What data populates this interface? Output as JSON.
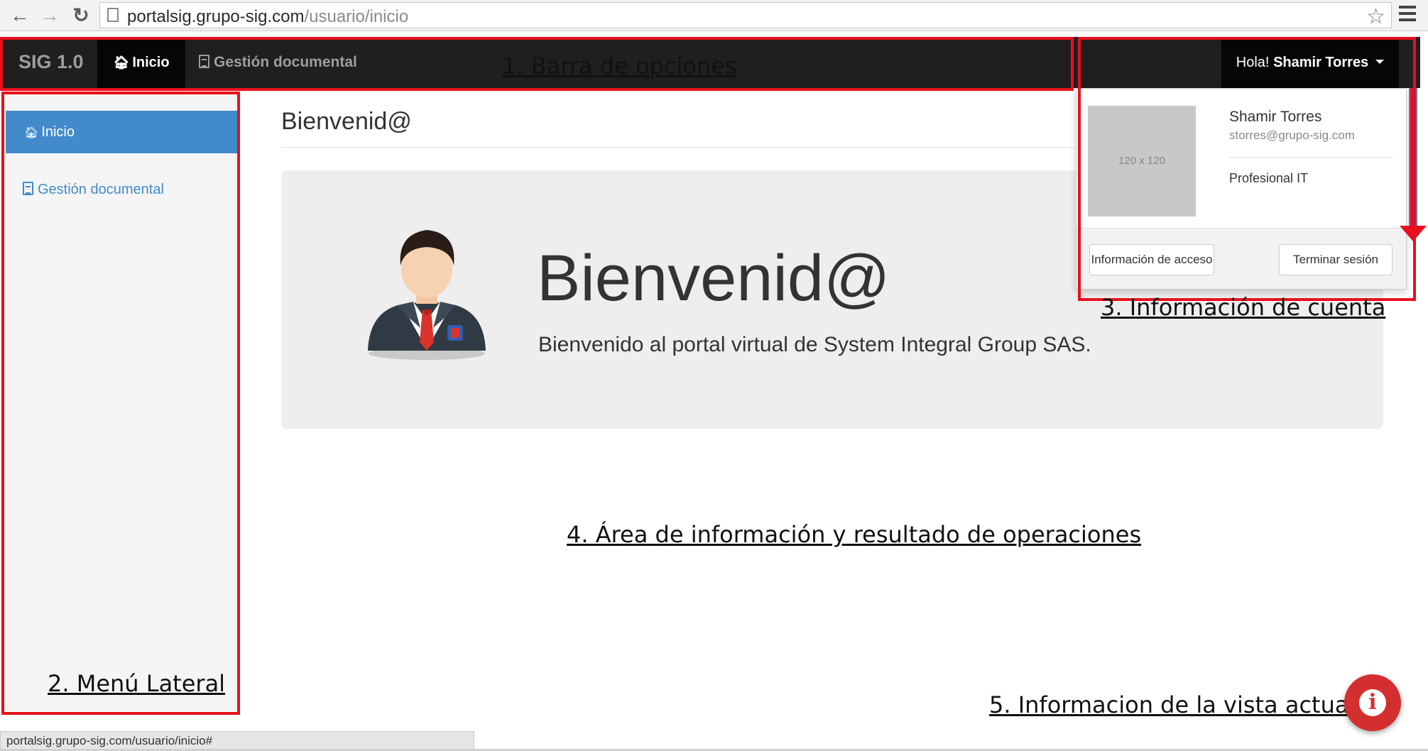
{
  "browser": {
    "url_host": "portalsig.grupo-sig.com",
    "url_path": "/usuario/inicio",
    "back_glyph": "←",
    "forward_glyph": "→",
    "reload_glyph": "↻",
    "star_glyph": "☆"
  },
  "navbar": {
    "brand": "SIG 1.0",
    "items": [
      {
        "label": "Inicio",
        "icon": "home-icon",
        "active": true
      },
      {
        "label": "Gestión documental",
        "icon": "document-icon",
        "active": false
      }
    ],
    "user_greeting": "Hola!",
    "user_name": "Shamir Torres"
  },
  "sidebar": {
    "items": [
      {
        "label": "Inicio",
        "icon": "home-icon",
        "active": true
      },
      {
        "label": "Gestión documental",
        "icon": "document-icon",
        "active": false
      }
    ]
  },
  "main": {
    "page_title": "Bienvenid@",
    "jumbotron": {
      "heading": "Bienvenid@",
      "text": "Bienvenido al portal virtual de System Integral Group SAS."
    }
  },
  "account": {
    "photo_placeholder": "120 x 120",
    "name": "Shamir Torres",
    "email": "storres@grupo-sig.com",
    "role": "Profesional IT",
    "access_button": "Información de acceso",
    "logout_button": "Terminar sesión"
  },
  "annotations": {
    "options_bar": "1. Barra de opciones",
    "side_menu": "2. Menú Lateral",
    "account_info": "3. Información de cuenta",
    "info_area": "4. Área de información y resultado de operaciones",
    "current_view": "5. Informacion de la vista actual",
    "highlight_color": "#e8101c"
  },
  "help_button": {
    "icon": "info-icon",
    "glyph": "i",
    "color": "#d32f2f"
  },
  "status_bar": {
    "text": "portalsig.grupo-sig.com/usuario/inicio#"
  },
  "colors": {
    "navbar_bg": "#1f1f1f",
    "active_sidebar": "#428bca",
    "jumbotron_bg": "#eeeeee"
  }
}
